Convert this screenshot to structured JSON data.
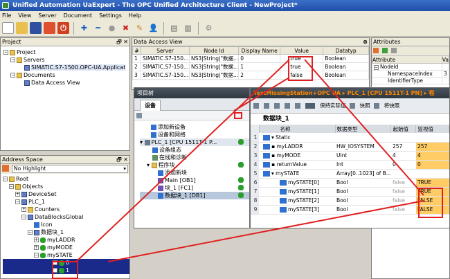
{
  "window": {
    "title": "Unified Automation UaExpert - The OPC Unified Architecture Client - NewProject*"
  },
  "menu": [
    "File",
    "View",
    "Server",
    "Document",
    "Settings",
    "Help"
  ],
  "project": {
    "title": "Project",
    "root": "Project",
    "servers": "Servers",
    "server_item": "SIMATIC.S7-1500.OPC-UA.Applicat",
    "documents": "Documents",
    "dav": "Data Access View"
  },
  "address": {
    "title": "Address Space",
    "filter": "No Highlight",
    "root": "Root",
    "objects": "Objects",
    "deviceset": "DeviceSet",
    "plc": "PLC_1",
    "counters": "Counters",
    "dbglobal": "DataBlocksGlobal",
    "icon": "Icon",
    "db": "数据块_1",
    "myladdr": "myLADDR",
    "mymode": "myMODE",
    "mystate": "mySTATE",
    "item0": "0",
    "item1": "1"
  },
  "dav": {
    "title": "Data Access View",
    "columns": [
      "#",
      "Server",
      "Node Id",
      "Display Name",
      "Value",
      "Datatyp"
    ],
    "rows": [
      {
        "n": "1",
        "server": "SIMATIC.S7-150...",
        "node": "NS3|String|\"数据...",
        "name": "0",
        "value": "true",
        "type": "Boolean"
      },
      {
        "n": "2",
        "server": "SIMATIC.S7-150...",
        "node": "NS3|String|\"数据...",
        "name": "1",
        "value": "true",
        "type": "Boolean"
      },
      {
        "n": "3",
        "server": "SIMATIC.S7-150...",
        "node": "NS3|String|\"数据...",
        "name": "2",
        "value": "false",
        "type": "Boolean"
      }
    ]
  },
  "attributes": {
    "title": "Attributes",
    "col": "Attribute",
    "col2": "Va",
    "items": [
      "NodeId",
      "NamespaceIndex",
      "IdentifierType"
    ],
    "vals": [
      "",
      "3",
      ""
    ]
  },
  "tia": {
    "left_title": "项目树",
    "devices_tab": "设备",
    "header": "TestMissingStation+OPC UA ▸ PLC_1 [CPU 1511T-1 PN] ▸ 程",
    "tree": [
      "添加新设备",
      "设备和网络",
      "PLC_1 [CPU 1511T-1 P...",
      "设备组态",
      "在线和诊断",
      "程序块",
      "添加新块",
      "Main [OB1]",
      "块_1 [FC1]",
      "数据块_1 [DB1]"
    ],
    "toolbar": {
      "keep": "保持实际值",
      "snapshot": "快照",
      "to_start": "将快照"
    },
    "db_title": "数据块_1",
    "db_cols": [
      "名称",
      "数据类型",
      "起始值",
      "监视值"
    ],
    "db_rows": [
      {
        "n": "1",
        "name": "Static",
        "type": "",
        "start": "",
        "mon": ""
      },
      {
        "n": "2",
        "name": "myLADDR",
        "type": "HW_IOSYSTEM",
        "start": "257",
        "mon": "257"
      },
      {
        "n": "3",
        "name": "myMODE",
        "type": "UInt",
        "start": "4",
        "mon": "4"
      },
      {
        "n": "4",
        "name": "returnValue",
        "type": "Int",
        "start": "0",
        "mon": "0"
      },
      {
        "n": "5",
        "name": "mySTATE",
        "type": "Array[0..1023] of B...",
        "start": "",
        "mon": ""
      },
      {
        "n": "6",
        "name": "mySTATE[0]",
        "type": "Bool",
        "start": "false",
        "mon": "TRUE"
      },
      {
        "n": "7",
        "name": "mySTATE[1]",
        "type": "Bool",
        "start": "false",
        "mon": "TRUE"
      },
      {
        "n": "8",
        "name": "mySTATE[2]",
        "type": "Bool",
        "start": "false",
        "mon": "FALSE"
      },
      {
        "n": "9",
        "name": "mySTATE[3]",
        "type": "Bool",
        "start": "false",
        "mon": "FALSE"
      }
    ]
  }
}
